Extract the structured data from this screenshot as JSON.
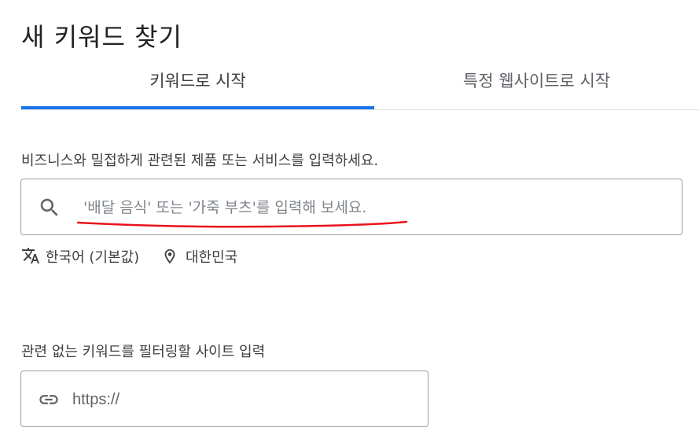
{
  "page": {
    "title": "새 키워드 찾기"
  },
  "tabs": [
    {
      "label": "키워드로 시작",
      "active": true
    },
    {
      "label": "특정 웹사이트로 시작",
      "active": false
    }
  ],
  "keyword_section": {
    "label": "비즈니스와 밀접하게 관련된 제품 또는 서비스를 입력하세요.",
    "search": {
      "placeholder": "'배달 음식' 또는 '가죽 부츠'를 입력해 보세요.",
      "value": "",
      "icon": "search-icon"
    },
    "language": {
      "icon": "translate-icon",
      "label": "한국어 (기본값)"
    },
    "location": {
      "icon": "location-pin-icon",
      "label": "대한민국"
    }
  },
  "site_filter": {
    "label": "관련 없는 키워드를 필터링할 사이트 입력",
    "input": {
      "placeholder": "https://",
      "value": "",
      "icon": "link-icon"
    }
  },
  "colors": {
    "accent": "#1a73e8",
    "annotation": "#e8131b",
    "text": "#202124",
    "muted": "#5f6368",
    "border": "#9aa0a6"
  }
}
